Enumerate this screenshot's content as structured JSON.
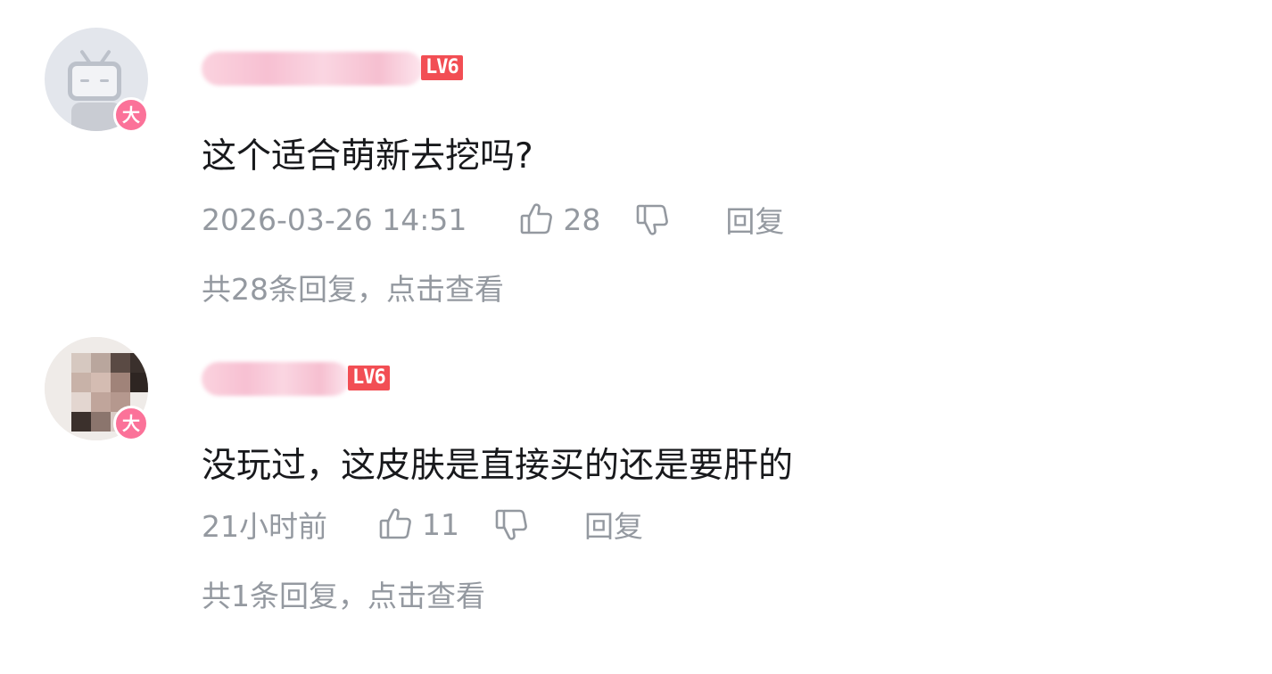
{
  "colors": {
    "background": "#ffffff",
    "content_text": "#18191c",
    "meta_text": "#9499a0",
    "level_badge": "#f24e54",
    "vip_badge": "#fb7299",
    "username_blur": "#f7c0d2"
  },
  "comments": [
    {
      "avatar_icon": "bilibili-tv-default-avatar",
      "vip_badge_label": "大",
      "level_badge": "LV6",
      "content": "这个适合萌新去挖吗?",
      "time": "2026-03-26 14:51",
      "like_icon": "thumbs-up-icon",
      "like_count": "28",
      "dislike_icon": "thumbs-down-icon",
      "reply_label": "回复",
      "sub_replies_text": "共28条回复，点击查看"
    },
    {
      "avatar_icon": "pixelated-photo-avatar",
      "vip_badge_label": "大",
      "level_badge": "LV6",
      "content": "没玩过，这皮肤是直接买的还是要肝的",
      "time": "21小时前",
      "like_icon": "thumbs-up-icon",
      "like_count": "11",
      "dislike_icon": "thumbs-down-icon",
      "reply_label": "回复",
      "sub_replies_text": "共1条回复，点击查看"
    }
  ]
}
